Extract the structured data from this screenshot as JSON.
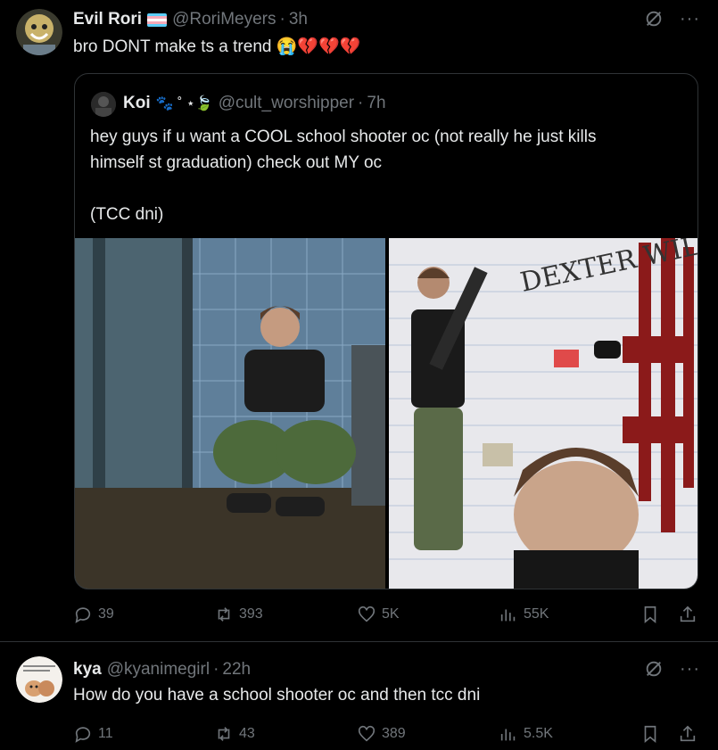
{
  "post": {
    "name": "Evil Rori",
    "handle": "@RoriMeyers",
    "dot": "·",
    "time": "3h",
    "text": "bro DONT make ts a trend 😭💔💔💔",
    "more": "···",
    "quote": {
      "name": "Koi",
      "name_emoji": "🐾 ˚ ⋆🍃",
      "handle": "@cult_worshipper",
      "dot": "·",
      "time": "7h",
      "lines": [
        "hey guys if u want a COOL school shooter oc (not really he just kills",
        "himself st graduation) check out MY oc",
        "",
        "(TCC dni)"
      ],
      "poster_title": "DEXTER WILKS"
    },
    "actions": {
      "replies": "39",
      "reposts": "393",
      "likes": "5K",
      "views": "55K"
    }
  },
  "reply": {
    "name": "kya",
    "handle": "@kyanimegirl",
    "dot": "·",
    "time": "22h",
    "text": "How do you have a school shooter oc and then tcc dni",
    "more": "···",
    "actions": {
      "replies": "11",
      "reposts": "43",
      "likes": "389",
      "views": "5.5K"
    }
  },
  "colors": {
    "background": "#000000",
    "text": "#e7e9ea",
    "muted": "#71767b",
    "border": "#2f3336"
  }
}
